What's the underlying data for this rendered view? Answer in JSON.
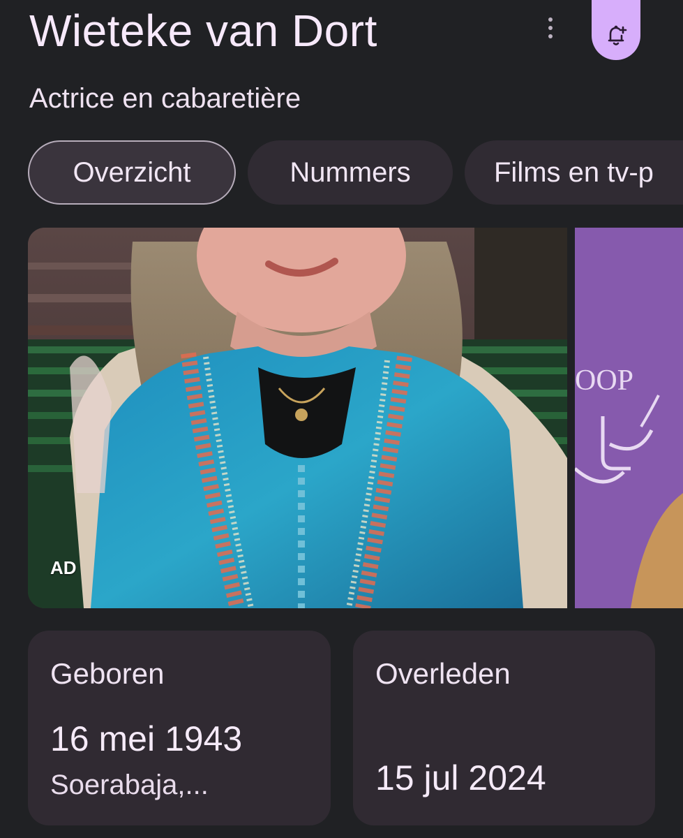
{
  "header": {
    "title": "Wieteke van Dort",
    "subtitle": "Actrice en cabaretière",
    "more_icon": "more-vert-icon",
    "bell_icon": "bell-plus-icon",
    "accent_color": "#d7aefb"
  },
  "tabs": [
    {
      "label": "Overzicht",
      "active": true
    },
    {
      "label": "Nummers",
      "active": false
    },
    {
      "label": "Films en tv-p",
      "active": false
    }
  ],
  "gallery": {
    "ad_label": "AD",
    "side_text": "OOP"
  },
  "facts": {
    "born": {
      "label": "Geboren",
      "date": "16 mei 1943",
      "place": "Soerabaja,..."
    },
    "died": {
      "label": "Overleden",
      "date": "15 jul 2024"
    }
  }
}
